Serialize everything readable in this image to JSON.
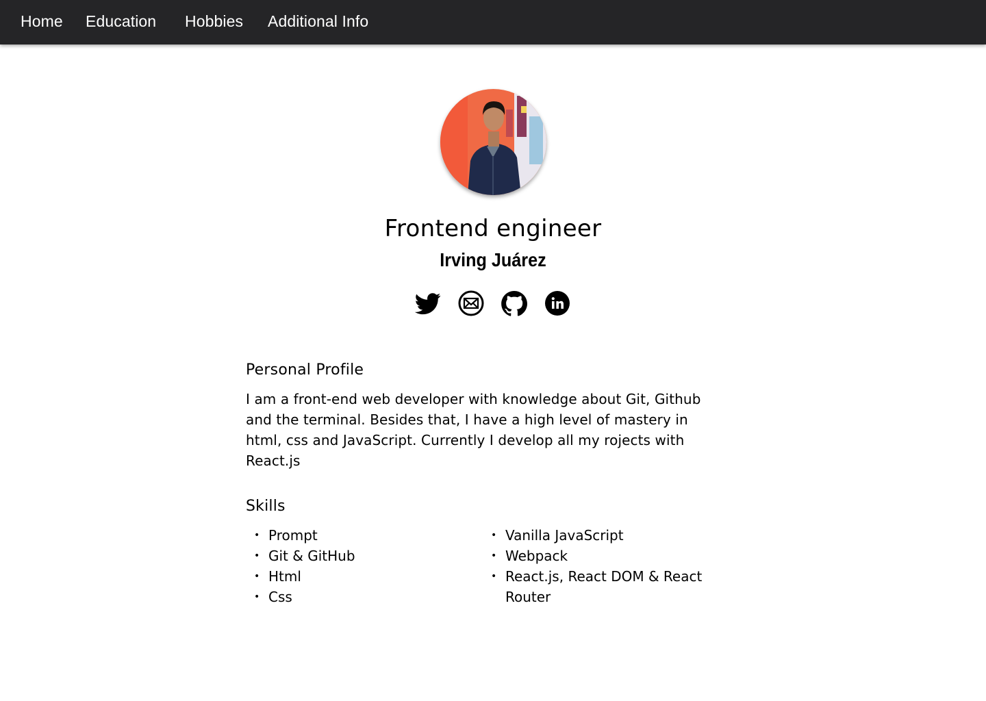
{
  "nav": {
    "home": "Home",
    "education": "Education",
    "hobbies": "Hobbies",
    "additional": "Additional Info"
  },
  "header": {
    "title": "Frontend engineer",
    "name": "Irving Juárez"
  },
  "socials": [
    {
      "icon": "twitter-icon"
    },
    {
      "icon": "email-icon"
    },
    {
      "icon": "github-icon"
    },
    {
      "icon": "linkedin-icon"
    }
  ],
  "profile": {
    "heading": "Personal Profile",
    "text": "I am a front-end web developer with knowledge about Git, Github and the terminal. Besides that, I have a high level of mastery in html, css and JavaScript. Currently I develop all my rojects with React.js"
  },
  "skills": {
    "heading": "Skills",
    "left": [
      "Prompt",
      "Git & GitHub",
      "Html",
      "Css"
    ],
    "right": [
      "Vanilla JavaScript",
      "Webpack",
      "React.js, React DOM & React Router"
    ]
  },
  "colors": {
    "nav_bg": "#252527",
    "nav_text": "#ffffff",
    "text": "#000000",
    "background": "#ffffff"
  }
}
